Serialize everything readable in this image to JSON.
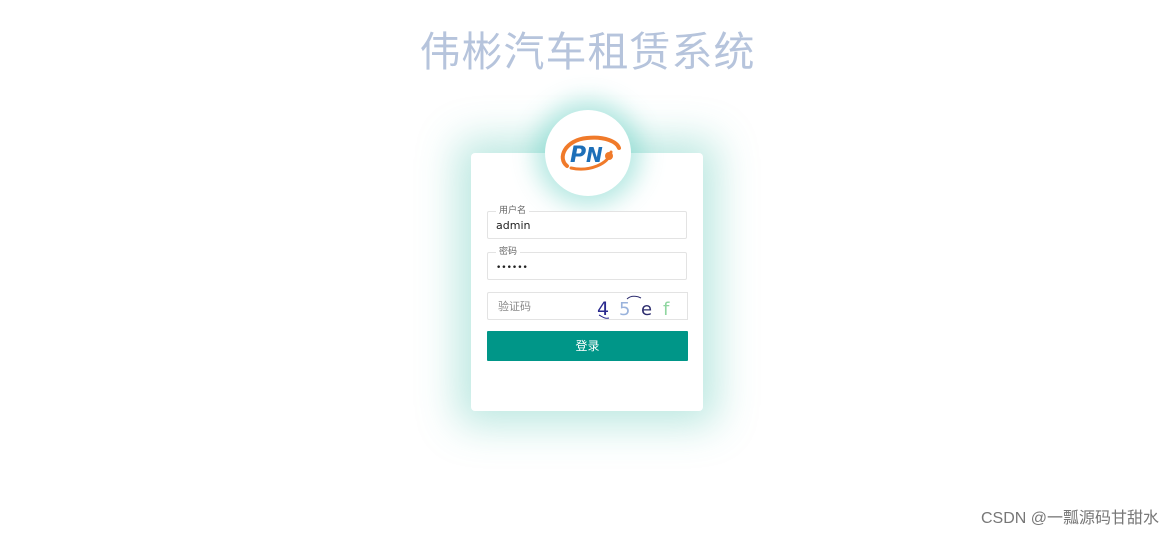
{
  "app": {
    "title": "伟彬汽车租赁系统"
  },
  "login_form": {
    "username": {
      "label": "用户名",
      "value": "admin"
    },
    "password": {
      "label": "密码",
      "value": "••••••"
    },
    "captcha": {
      "placeholder": "验证码",
      "chars": [
        "4",
        "5",
        "e",
        "f"
      ],
      "char_colors": [
        "#2a2a8f",
        "#9ab3dc",
        "#2d2d6e",
        "#8fd6a0"
      ]
    },
    "submit_label": "登录"
  },
  "theme": {
    "accent": "#009688",
    "title_color": "#b6c4dc",
    "glow": "#40beaa"
  },
  "watermark": "CSDN @一瓢源码甘甜水"
}
